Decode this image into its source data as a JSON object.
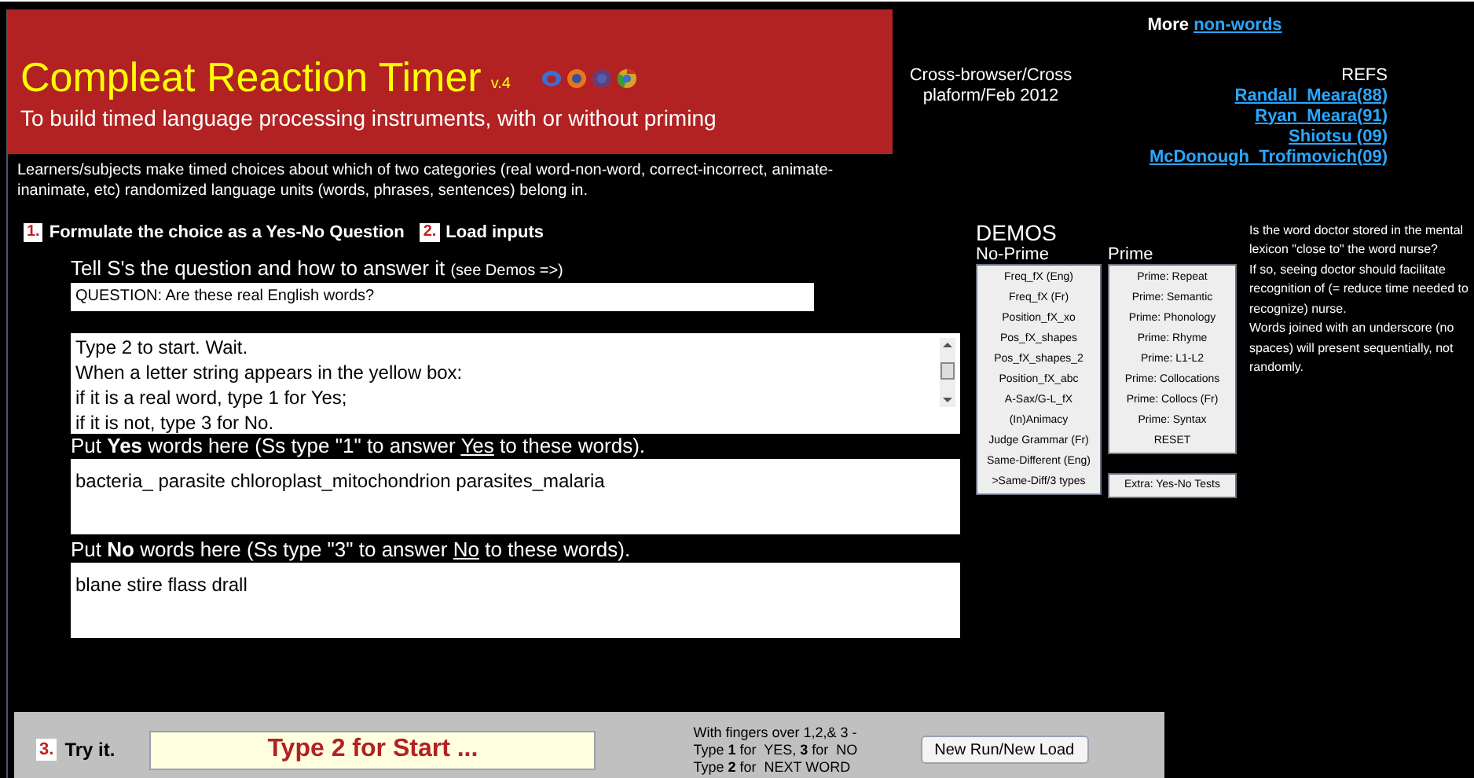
{
  "header": {
    "title": "Compleat Reaction Timer",
    "version": "v.4",
    "subtitle": "To build timed language processing instruments, with or without priming"
  },
  "platform_note": [
    "Cross-browser/Cross",
    "plaform/Feb 2012"
  ],
  "more": {
    "label": "More",
    "link": "non-words"
  },
  "refs": {
    "title": "REFS",
    "links": [
      "Randall_Meara(88)",
      "Ryan_Meara(91)",
      "Shiotsu (09)",
      "McDonough_Trofimovich(09)"
    ]
  },
  "description": "Learners/subjects make timed choices about which of two categories (real word-non-word, correct-incorrect, animate-inanimate, etc) randomized language units (words, phrases, sentences) belong in.",
  "steps": [
    {
      "number": "1.",
      "label": "Formulate the choice as a Yes-No Question"
    },
    {
      "number": "2.",
      "label": "Load inputs"
    }
  ],
  "question": {
    "label": "Tell S's the question and how to answer it",
    "hint": "(see Demos =>)",
    "value": "QUESTION: Are these real English words?"
  },
  "instructions": [
    "Type 2 to start. Wait.",
    "When a letter string appears in the yellow box:",
    "if it is a real word, type 1 for Yes;",
    "if it is not, type 3 for No."
  ],
  "yes_words": {
    "label": {
      "before": "Put ",
      "bold": "Yes",
      "middle": " words here (Ss type \"1\" to answer ",
      "underlined": "Yes",
      "after": " to these words)."
    },
    "value": "bacteria_ parasite chloroplast_mitochondrion parasites_malaria"
  },
  "no_words": {
    "label": {
      "before": "Put ",
      "bold": "No",
      "middle": " words here (Ss type \"3\" to answer ",
      "underlined": "No",
      "after": " to these words)."
    },
    "value": "blane stire flass drall"
  },
  "demos": {
    "title": "DEMOS",
    "no_prime": {
      "title": "No-Prime",
      "items": [
        "Freq_fX (Eng)",
        "Freq_fX  (Fr)",
        "Position_fX_xo",
        "Pos_fX_shapes",
        "Pos_fX_shapes_2",
        "Position_fX_abc",
        "A-Sax/G-L_fX",
        "(In)Animacy",
        "Judge Grammar (Fr)",
        "Same-Different (Eng)",
        ">Same-Diff/3 types"
      ]
    },
    "prime": {
      "title": "Prime",
      "items": [
        "Prime: Repeat",
        "Prime: Semantic",
        "Prime: Phonology",
        "Prime: Rhyme",
        "Prime: L1-L2",
        "Prime: Collocations",
        "Prime: Collocs (Fr)",
        "Prime: Syntax",
        "RESET"
      ],
      "extra": "Extra: Yes-No Tests"
    }
  },
  "note": [
    "Is the word doctor stored in the mental lexicon \"close to\" the word nurse?",
    "If so, seeing doctor should facilitate recognition of (= reduce time needed to recognize) nurse.",
    "Words joined with an underscore (no spaces) will present sequentially, not randomly."
  ],
  "try_bar": {
    "number": "3.",
    "label": "Try it.",
    "display": "Type 2 for Start ...",
    "help": [
      "With fingers over 1,2,& 3 -",
      "Type **1** for  YES, **3** for  NO",
      "Type **2** for  NEXT WORD"
    ],
    "button": "New Run/New Load"
  }
}
